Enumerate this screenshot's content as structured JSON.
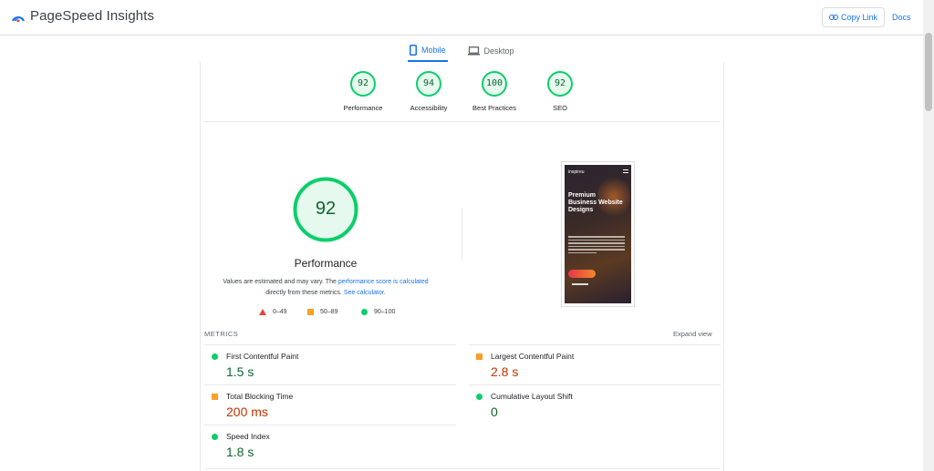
{
  "app": {
    "title": "PageSpeed Insights"
  },
  "header": {
    "copy_link": "Copy Link",
    "docs": "Docs"
  },
  "tabs": [
    {
      "label": "Mobile",
      "active": true
    },
    {
      "label": "Desktop",
      "active": false
    }
  ],
  "categories": [
    {
      "score": "92",
      "label": "Performance"
    },
    {
      "score": "94",
      "label": "Accessibility"
    },
    {
      "score": "100",
      "label": "Best Practices"
    },
    {
      "score": "92",
      "label": "SEO"
    }
  ],
  "performance": {
    "score": "92",
    "title": "Performance",
    "desc_1": "Values are estimated and may vary. The ",
    "desc_link_1": "performance score is calculated",
    "desc_2": "directly from these metrics. ",
    "desc_link_2": "See calculator."
  },
  "legend": [
    {
      "range": "0–49",
      "color": "#ea4335",
      "shape": "triangle"
    },
    {
      "range": "50–89",
      "color": "#fa9f28",
      "shape": "square"
    },
    {
      "range": "90–100",
      "color": "#0cce6b",
      "shape": "circle"
    }
  ],
  "screenshot": {
    "brand": "inspireu",
    "headline": "Premium Business Website Designs"
  },
  "metrics": {
    "heading": "METRICS",
    "expand": "Expand view",
    "items": [
      {
        "label": "First Contentful Paint",
        "value": "1.5 s",
        "status": "good"
      },
      {
        "label": "Largest Contentful Paint",
        "value": "2.8 s",
        "status": "average"
      },
      {
        "label": "Total Blocking Time",
        "value": "200 ms",
        "status": "average"
      },
      {
        "label": "Cumulative Layout Shift",
        "value": "0",
        "status": "good"
      },
      {
        "label": "Speed Index",
        "value": "1.8 s",
        "status": "good"
      }
    ]
  },
  "colors": {
    "accent": "#1a73e8",
    "good": "#0cce6b",
    "average": "#fa9f28",
    "poor": "#ea4335"
  }
}
